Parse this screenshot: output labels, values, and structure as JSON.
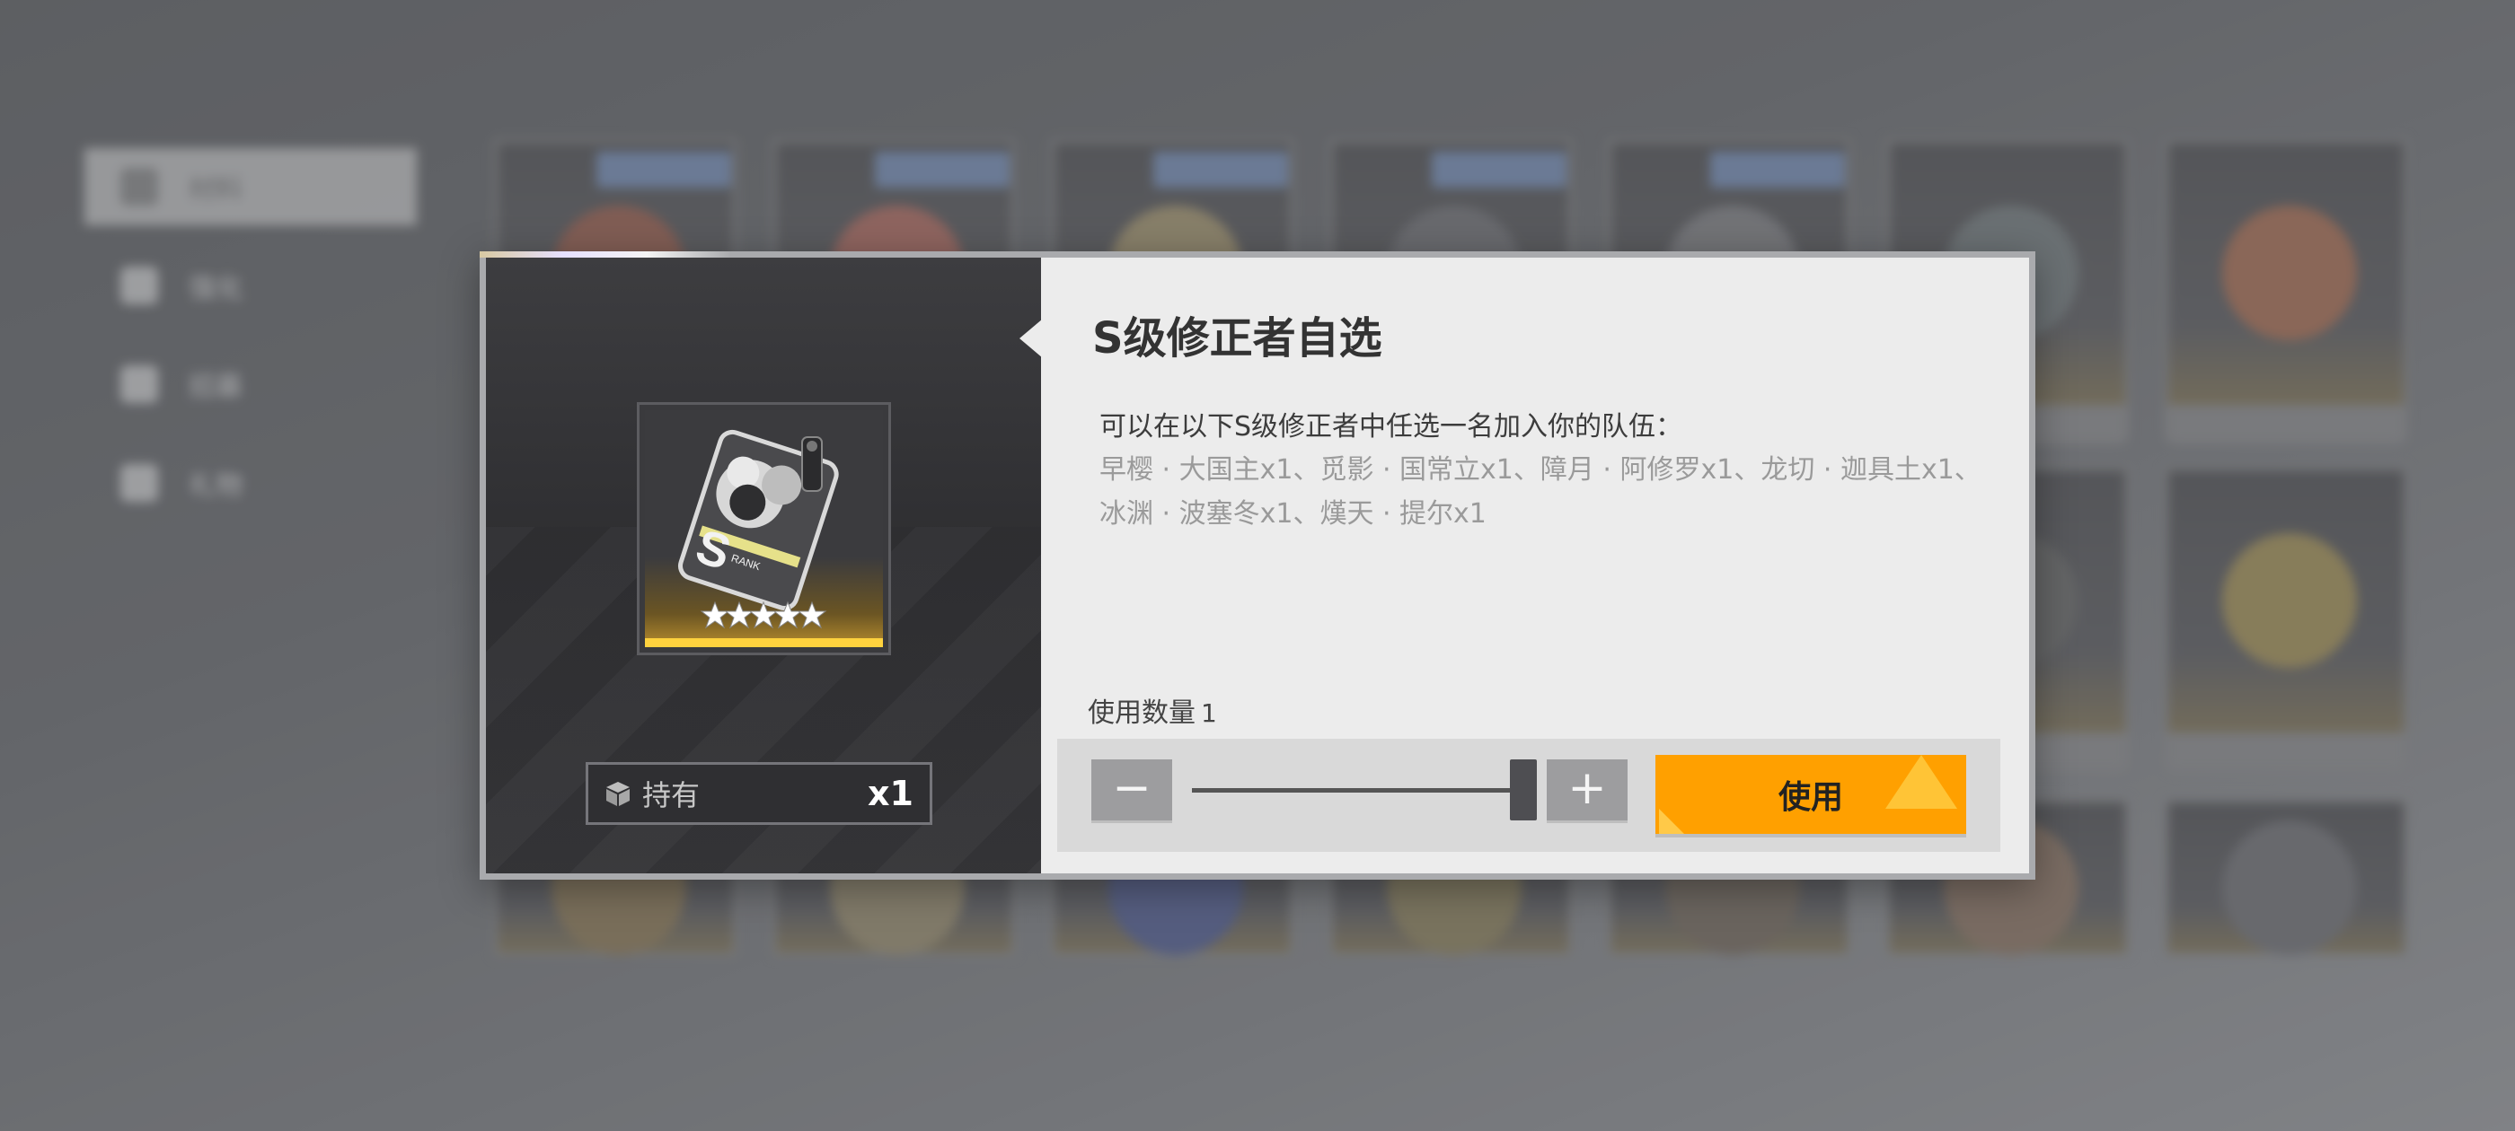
{
  "background": {
    "sidebar": {
      "items": [
        {
          "label": "材料",
          "active": true
        },
        {
          "label": "强化",
          "active": false
        },
        {
          "label": "招募",
          "active": false
        },
        {
          "label": "礼物",
          "active": false
        }
      ]
    },
    "inventory": {
      "rows": 3,
      "columns": 7
    }
  },
  "dialog": {
    "title": "S级修正者自选",
    "description": "可以在以下S级修正者中任选一名加入你的队伍：",
    "options_text": "早樱 · 大国主x1、觅影 · 国常立x1、障月 · 阿修罗x1、龙切 · 迦具土x1、冰渊 · 波塞冬x1、熯天 · 提尔x1",
    "item": {
      "icon": "s-rank-card-icon",
      "rank_letter": "S",
      "rank_text": "RANK",
      "stars": 5
    },
    "holding": {
      "label": "持有",
      "count": "x1"
    },
    "quantity": {
      "label": "使用数量",
      "value": "1"
    },
    "controls": {
      "minus": "−",
      "plus": "+",
      "use_label": "使用",
      "slider_value_fraction": 1.0
    },
    "colors": {
      "accent": "#ffa000",
      "rank_bar": "#ffd23e",
      "dialog_bg": "#ececec",
      "left_pane_bg": "#333336"
    }
  }
}
